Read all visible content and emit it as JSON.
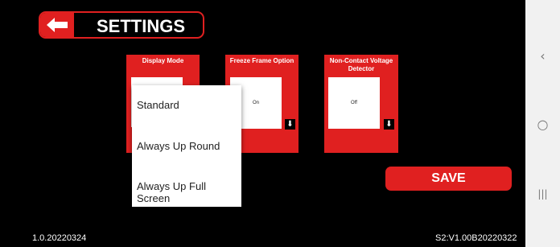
{
  "header": {
    "title": "SETTINGS"
  },
  "cards": [
    {
      "label": "Display Mode",
      "value": ""
    },
    {
      "label": "Freeze Frame Option",
      "value": "On"
    },
    {
      "label": "Non-Contact Voltage Detector",
      "value": "Off"
    }
  ],
  "dropdown": {
    "options": [
      "Standard",
      "Always Up Round",
      "Always Up Full Screen"
    ]
  },
  "save": {
    "label": "SAVE"
  },
  "footer": {
    "version_left": "1.0.20220324",
    "version_right": "S2:V1.00B20220322"
  },
  "navbar": {
    "back_glyph": "‹",
    "home_glyph": "○",
    "recents_glyph": "|||"
  },
  "colors": {
    "accent": "#e02020",
    "background": "#000000",
    "navbar": "#f1f1f1"
  }
}
